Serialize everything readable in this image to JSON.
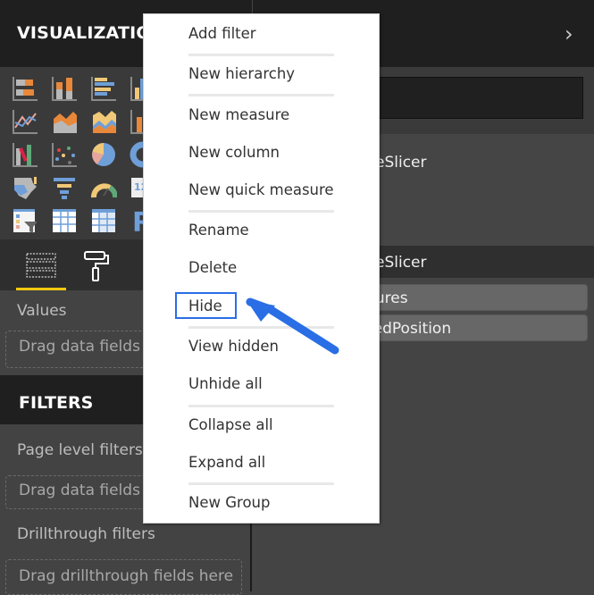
{
  "visualizations": {
    "title": "VISUALIZATIONS",
    "icons": [
      "stacked-bar-chart-icon",
      "stacked-column-chart-icon",
      "clustered-bar-chart-icon",
      "clustered-column-chart-icon",
      "line-chart-icon",
      "area-chart-icon",
      "stacked-area-chart-icon",
      "line-column-chart-icon",
      "ribbon-chart-icon",
      "scatter-chart-icon",
      "pie-chart-icon",
      "donut-chart-icon",
      "filled-map-icon",
      "funnel-icon",
      "gauge-icon",
      "card-icon",
      "slicer-icon",
      "table-icon",
      "matrix-icon",
      "r-visual-icon"
    ],
    "tabs": [
      "fields-tab",
      "format-tab"
    ],
    "values_label": "Values",
    "values_drop": "Drag data fields here"
  },
  "filters": {
    "title": "FILTERS",
    "page_label": "Page level filters",
    "page_drop": "Drag data fields here",
    "drill_label": "Drillthrough filters",
    "drill_drop": "Drag drillthrough fields here"
  },
  "fields": {
    "table1": "eSlicer",
    "table2": "eSlicer",
    "items": [
      "sures",
      "tedPosition"
    ]
  },
  "context_menu": {
    "items": [
      "Add filter",
      "New hierarchy",
      "New measure",
      "New column",
      "New quick measure",
      "Rename",
      "Delete",
      "Hide",
      "View hidden",
      "Unhide all",
      "Collapse all",
      "Expand all",
      "New Group"
    ],
    "highlighted": "Hide"
  },
  "colors": {
    "accent": "#f2c80f",
    "annotation": "#2a6ee6",
    "orange": "#e8883a",
    "blue": "#6f9fd8",
    "tan": "#f0c878"
  }
}
